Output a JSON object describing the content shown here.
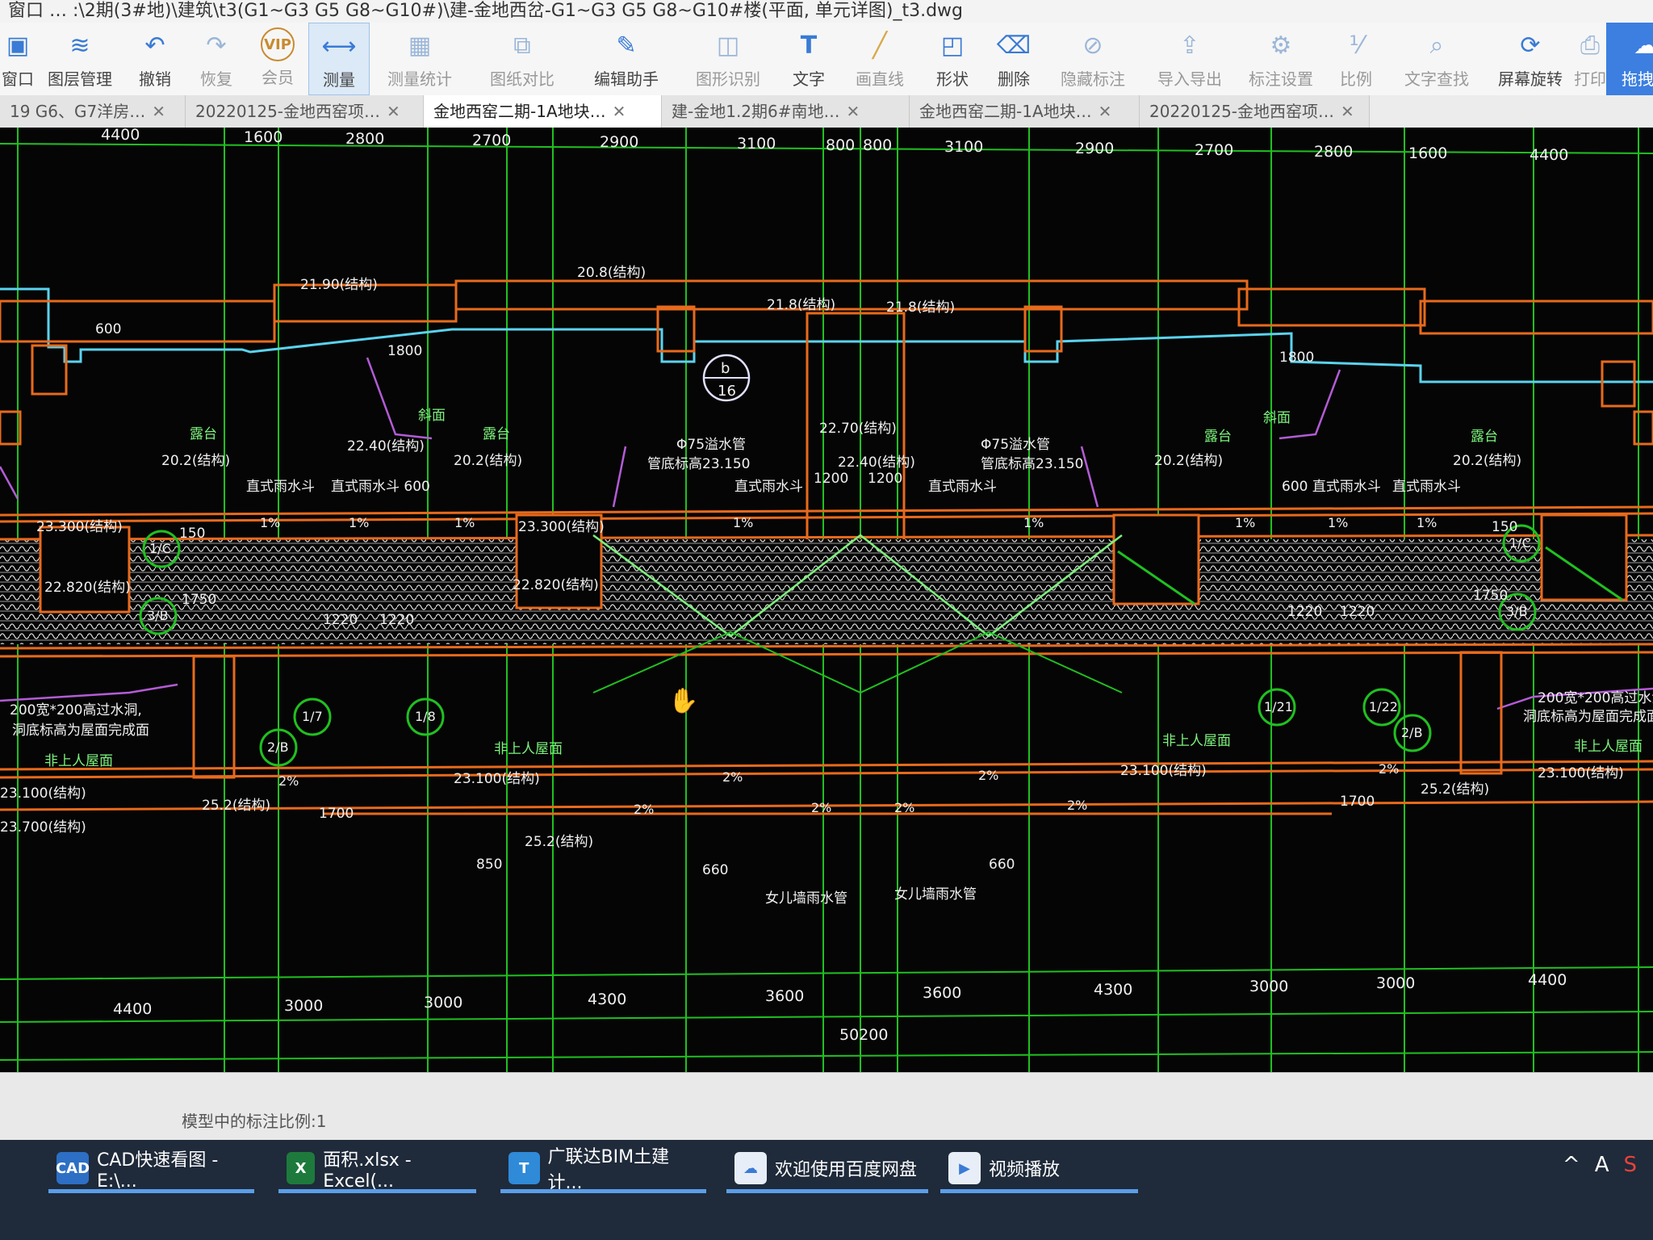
{
  "window": {
    "title": "窗口 … :\\2期(3#地)\\建筑\\t3(G1~G3 G5 G8~G10#)\\建-金地西岔-G1~G3 G5 G8~G10#楼(平面, 单元详图)_t3.dwg"
  },
  "toolbar": {
    "items": [
      {
        "label": "窗口",
        "icon": "window-icon"
      },
      {
        "label": "图层管理",
        "icon": "layers-icon"
      },
      {
        "label": "撤销",
        "icon": "undo-icon"
      },
      {
        "label": "恢复",
        "icon": "redo-icon"
      },
      {
        "label": "会员",
        "icon": "vip-icon"
      },
      {
        "label": "测量",
        "icon": "measure-icon"
      },
      {
        "label": "测量统计",
        "icon": "measure-stats-icon"
      },
      {
        "label": "图纸对比",
        "icon": "compare-icon"
      },
      {
        "label": "编辑助手",
        "icon": "edit-assistant-icon"
      },
      {
        "label": "图形识别",
        "icon": "shape-recognition-icon"
      },
      {
        "label": "文字",
        "icon": "text-icon"
      },
      {
        "label": "画直线",
        "icon": "line-icon"
      },
      {
        "label": "形状",
        "icon": "shape-icon"
      },
      {
        "label": "删除",
        "icon": "eraser-icon"
      },
      {
        "label": "隐藏标注",
        "icon": "hide-annotation-icon"
      },
      {
        "label": "导入导出",
        "icon": "import-export-icon"
      },
      {
        "label": "标注设置",
        "icon": "annotation-settings-icon"
      },
      {
        "label": "比例",
        "icon": "scale-icon"
      },
      {
        "label": "文字查找",
        "icon": "text-search-icon"
      },
      {
        "label": "屏幕旋转",
        "icon": "rotate-screen-icon"
      },
      {
        "label": "打印",
        "icon": "print-icon"
      },
      {
        "label": "拖拽上",
        "icon": "baidu-cloud-icon"
      }
    ]
  },
  "tabs": [
    {
      "label": "19 G6、G7洋房…"
    },
    {
      "label": "20220125-金地西窑项…"
    },
    {
      "label": "金地西窑二期-1A地块…"
    },
    {
      "label": "建-金地1.2期6#南地…"
    },
    {
      "label": "金地西窑二期-1A地块…"
    },
    {
      "label": "20220125-金地西窑项…"
    }
  ],
  "drawing": {
    "top_dims": [
      "4400",
      "1600",
      "2800",
      "2700",
      "2900",
      "3100",
      "800",
      "800",
      "3100",
      "2900",
      "2700",
      "2800",
      "1600",
      "4400"
    ],
    "bottom_dims": [
      "4400",
      "3000",
      "3000",
      "4300",
      "3600",
      "3600",
      "4300",
      "3000",
      "3000",
      "4400"
    ],
    "total_dim": "50200",
    "labels": {
      "l1": "21.90(结构)",
      "l2": "20.8(结构)",
      "l3": "21.8(结构)",
      "l4": "21.8(结构)",
      "l5": "22.70(结构)",
      "l6": "22.40(结构)",
      "l7": "22.40(结构)",
      "l8": "20.2(结构)",
      "l9": "20.2(结构)",
      "l10": "20.2(结构)",
      "l11": "20.2(结构)",
      "l12": "23.300(结构)",
      "l13": "23.300(结构)",
      "l14": "22.820(结构)",
      "l15": "22.820(结构)",
      "l16": "Φ75溢水管",
      "l17": "管底标高23.150",
      "l18": "Φ75溢水管",
      "l19": "管底标高23.150",
      "l20": "直式雨水斗",
      "l21": "直式雨水斗 600",
      "l22": "直式雨水斗",
      "l23": "直式雨水斗",
      "l24": "600 直式雨水斗",
      "l25": "直式雨水斗",
      "l26": "露台",
      "l27": "露台",
      "l28": "露台",
      "l29": "露台",
      "l30": "斜面",
      "l31": "斜面",
      "l32": "1200",
      "l33": "1200",
      "l34": "1220",
      "l35": "1220",
      "l36": "1220",
      "l37": "1220",
      "l38": "200宽*200高过水洞,",
      "l39": "洞底标高为屋面完成面",
      "l40": "200宽*200高过水洞,",
      "l41": "洞底标高为屋面完成面",
      "l42": "非上人屋面",
      "l43": "非上人屋面",
      "l44": "非上人屋面",
      "l45": "非上人屋面",
      "l46": "23.100(结构)",
      "l47": "23.100(结构)",
      "l48": "23.100(结构)",
      "l49": "23.100(结构)",
      "l50": "23.700(结构)",
      "l51": "25.2(结构)",
      "l52": "25.2(结构)",
      "l53": "25.2(结构)",
      "l54": "女儿墙雨水管",
      "l55": "女儿墙雨水管",
      "l56": "660",
      "l57": "660",
      "l58": "1700",
      "l59": "1700",
      "l60": "850",
      "l61": "1750",
      "l62": "1750",
      "l63": "1800",
      "l64": "1800",
      "l65": "600",
      "l66": "150",
      "l67": "150",
      "s1": "2%",
      "s2": "2%",
      "s3": "2%",
      "s4": "2%",
      "s5": "2%",
      "s6": "2%",
      "s7": "2%",
      "s8": "2%",
      "s9": "1%",
      "s10": "1%",
      "s11": "1%",
      "s12": "1%",
      "s13": "1%",
      "s14": "1%",
      "s15": "1%",
      "s16": "1%"
    },
    "callout_b_top": "b",
    "callout_b_bottom": "16",
    "axes": [
      "1/C",
      "1/C",
      "3/B",
      "3/B",
      "1/7",
      "1/8",
      "2/B",
      "1/21",
      "1/22",
      "2/B"
    ]
  },
  "statusbar": {
    "scale_text": "模型中的标注比例:1"
  },
  "taskbar": {
    "items": [
      {
        "label": "CAD快速看图 - E:\\...",
        "icon": "cad-icon"
      },
      {
        "label": "面积.xlsx - Excel(...",
        "icon": "excel-icon"
      },
      {
        "label": "广联达BIM土建计...",
        "icon": "glodon-icon"
      },
      {
        "label": "欢迎使用百度网盘",
        "icon": "baidu-netdisk-icon"
      },
      {
        "label": "视频播放",
        "icon": "video-icon"
      }
    ],
    "tray": [
      "^",
      "A",
      "S"
    ]
  },
  "colors": {
    "grid": "#20c020",
    "wall": "#e86a1c",
    "text_green": "#7cf27c",
    "text_white": "#f0f0f0",
    "cyan": "#5ad3ef",
    "yellow": "#f2d21a",
    "magenta": "#b35cd6",
    "accent": "#3a7bd5"
  }
}
